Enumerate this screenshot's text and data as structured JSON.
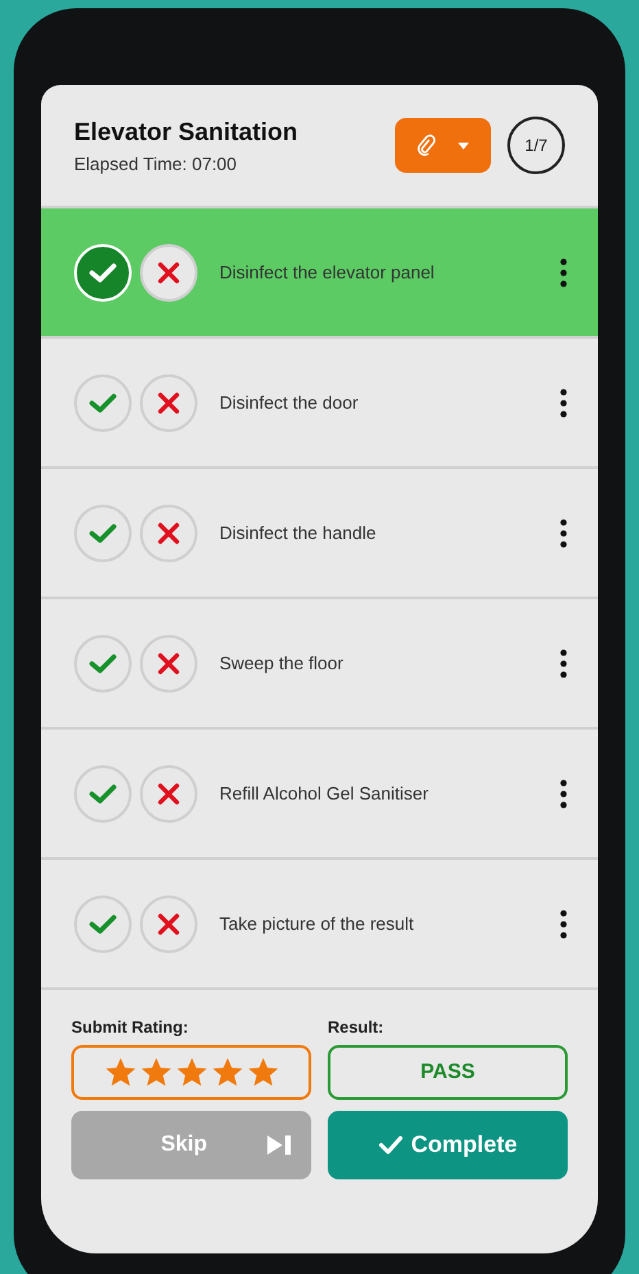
{
  "header": {
    "title": "Elevator Sanitation",
    "elapsed": "Elapsed Time: 07:00",
    "counter": "1/7"
  },
  "tasks": [
    {
      "label": "Disinfect the elevator panel",
      "completed": true
    },
    {
      "label": "Disinfect the door",
      "completed": false
    },
    {
      "label": "Disinfect the handle",
      "completed": false
    },
    {
      "label": "Sweep the floor",
      "completed": false
    },
    {
      "label": "Refill Alcohol Gel Sanitiser",
      "completed": false
    },
    {
      "label": "Take picture of the result",
      "completed": false
    }
  ],
  "rating": {
    "label": "Submit Rating:",
    "stars": 5
  },
  "result": {
    "label": "Result:",
    "value": "PASS"
  },
  "buttons": {
    "skip": {
      "label": "Skip",
      "disabled": true
    },
    "complete": {
      "label": "Complete"
    }
  }
}
